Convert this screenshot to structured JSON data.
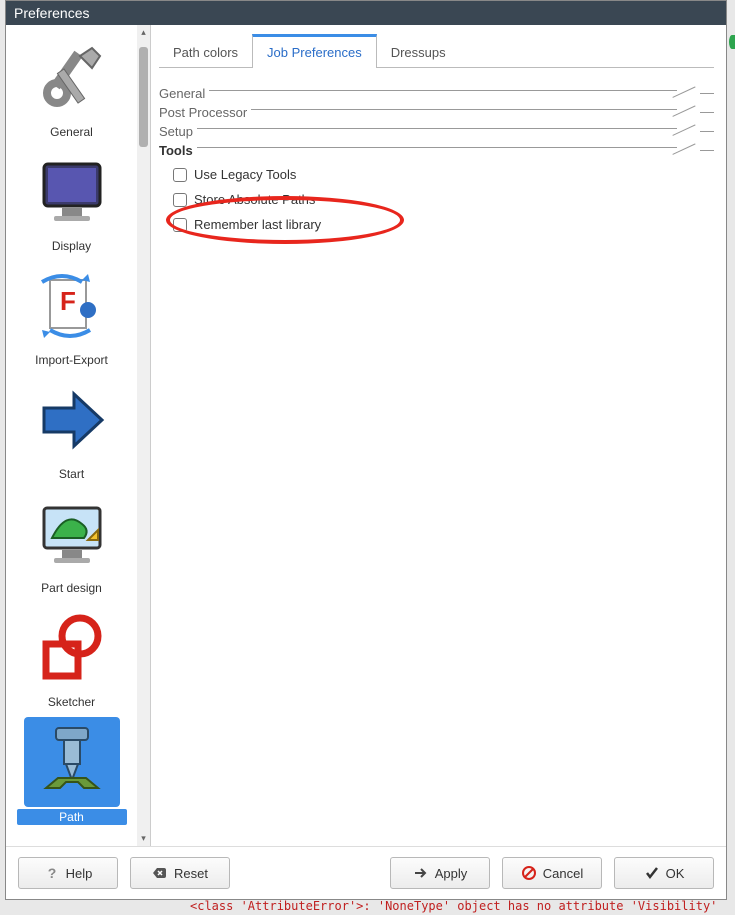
{
  "window": {
    "title": "Preferences"
  },
  "sidebar": {
    "items": [
      {
        "id": "general",
        "label": "General"
      },
      {
        "id": "display",
        "label": "Display"
      },
      {
        "id": "import-export",
        "label": "Import-Export"
      },
      {
        "id": "start",
        "label": "Start"
      },
      {
        "id": "part-design",
        "label": "Part design"
      },
      {
        "id": "sketcher",
        "label": "Sketcher"
      },
      {
        "id": "path",
        "label": "Path"
      }
    ],
    "selected": "path"
  },
  "tabs": {
    "items": [
      {
        "id": "path-colors",
        "label": "Path colors"
      },
      {
        "id": "job-prefs",
        "label": "Job Preferences"
      },
      {
        "id": "dressups",
        "label": "Dressups"
      }
    ],
    "active": "job-prefs"
  },
  "sections": {
    "general": "General",
    "post_processor": "Post Processor",
    "setup": "Setup",
    "tools": "Tools"
  },
  "checkboxes": {
    "use_legacy": {
      "label": "Use Legacy Tools",
      "checked": false
    },
    "store_abs": {
      "label": "Store Absolute Paths",
      "checked": false
    },
    "remember_lib": {
      "label": "Remember last library",
      "checked": false
    }
  },
  "buttons": {
    "help": "Help",
    "reset": "Reset",
    "apply": "Apply",
    "cancel": "Cancel",
    "ok": "OK"
  },
  "error_text": "<class 'AttributeError'>: 'NoneType' object has no attribute 'Visibility'"
}
